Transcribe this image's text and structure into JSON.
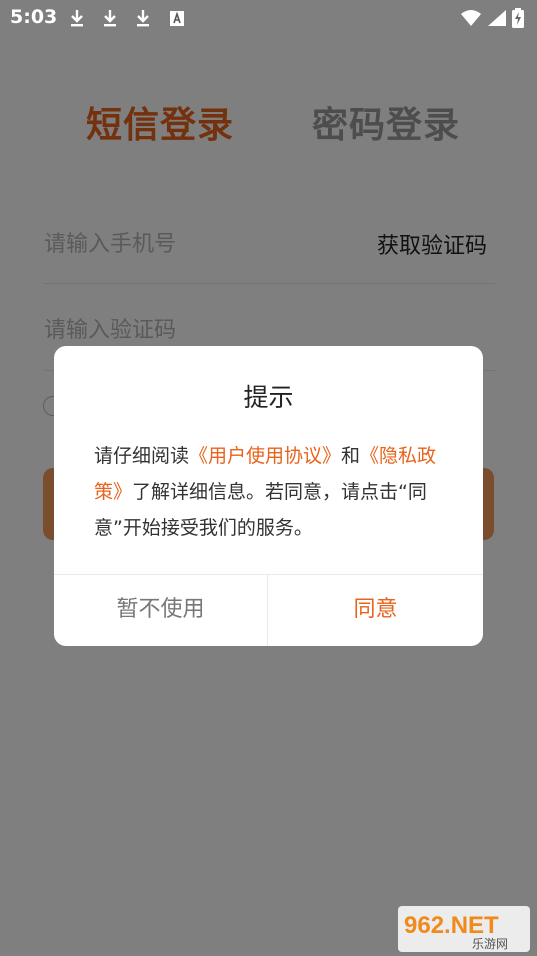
{
  "status_bar": {
    "time": "5:03",
    "icons": [
      "download-icon",
      "download-icon",
      "download-icon",
      "font-icon",
      "wifi-icon",
      "signal-icon",
      "battery-charging-icon"
    ]
  },
  "tabs": [
    {
      "label": "短信登录",
      "active": true
    },
    {
      "label": "密码登录",
      "active": false
    }
  ],
  "form": {
    "phone_placeholder": "请输入手机号",
    "get_code_label": "获取验证码",
    "code_placeholder": "请输入验证码"
  },
  "dialog": {
    "title": "提示",
    "body_prefix": "请仔细阅读",
    "link_user_agreement": "《用户使用协议》",
    "body_and": "和",
    "link_privacy": "《隐私政策》",
    "body_suffix": "了解详细信息。若同意，请点击“同意”开始接受我们的服务。",
    "decline_label": "暂不使用",
    "agree_label": "同意"
  },
  "watermark": {
    "logo_text": "962.NET",
    "caption": "乐游网"
  },
  "colors": {
    "accent": "#e8631c",
    "overlay": "rgba(0,0,0,0.5)",
    "inactive_tab": "#9a9a9a"
  }
}
